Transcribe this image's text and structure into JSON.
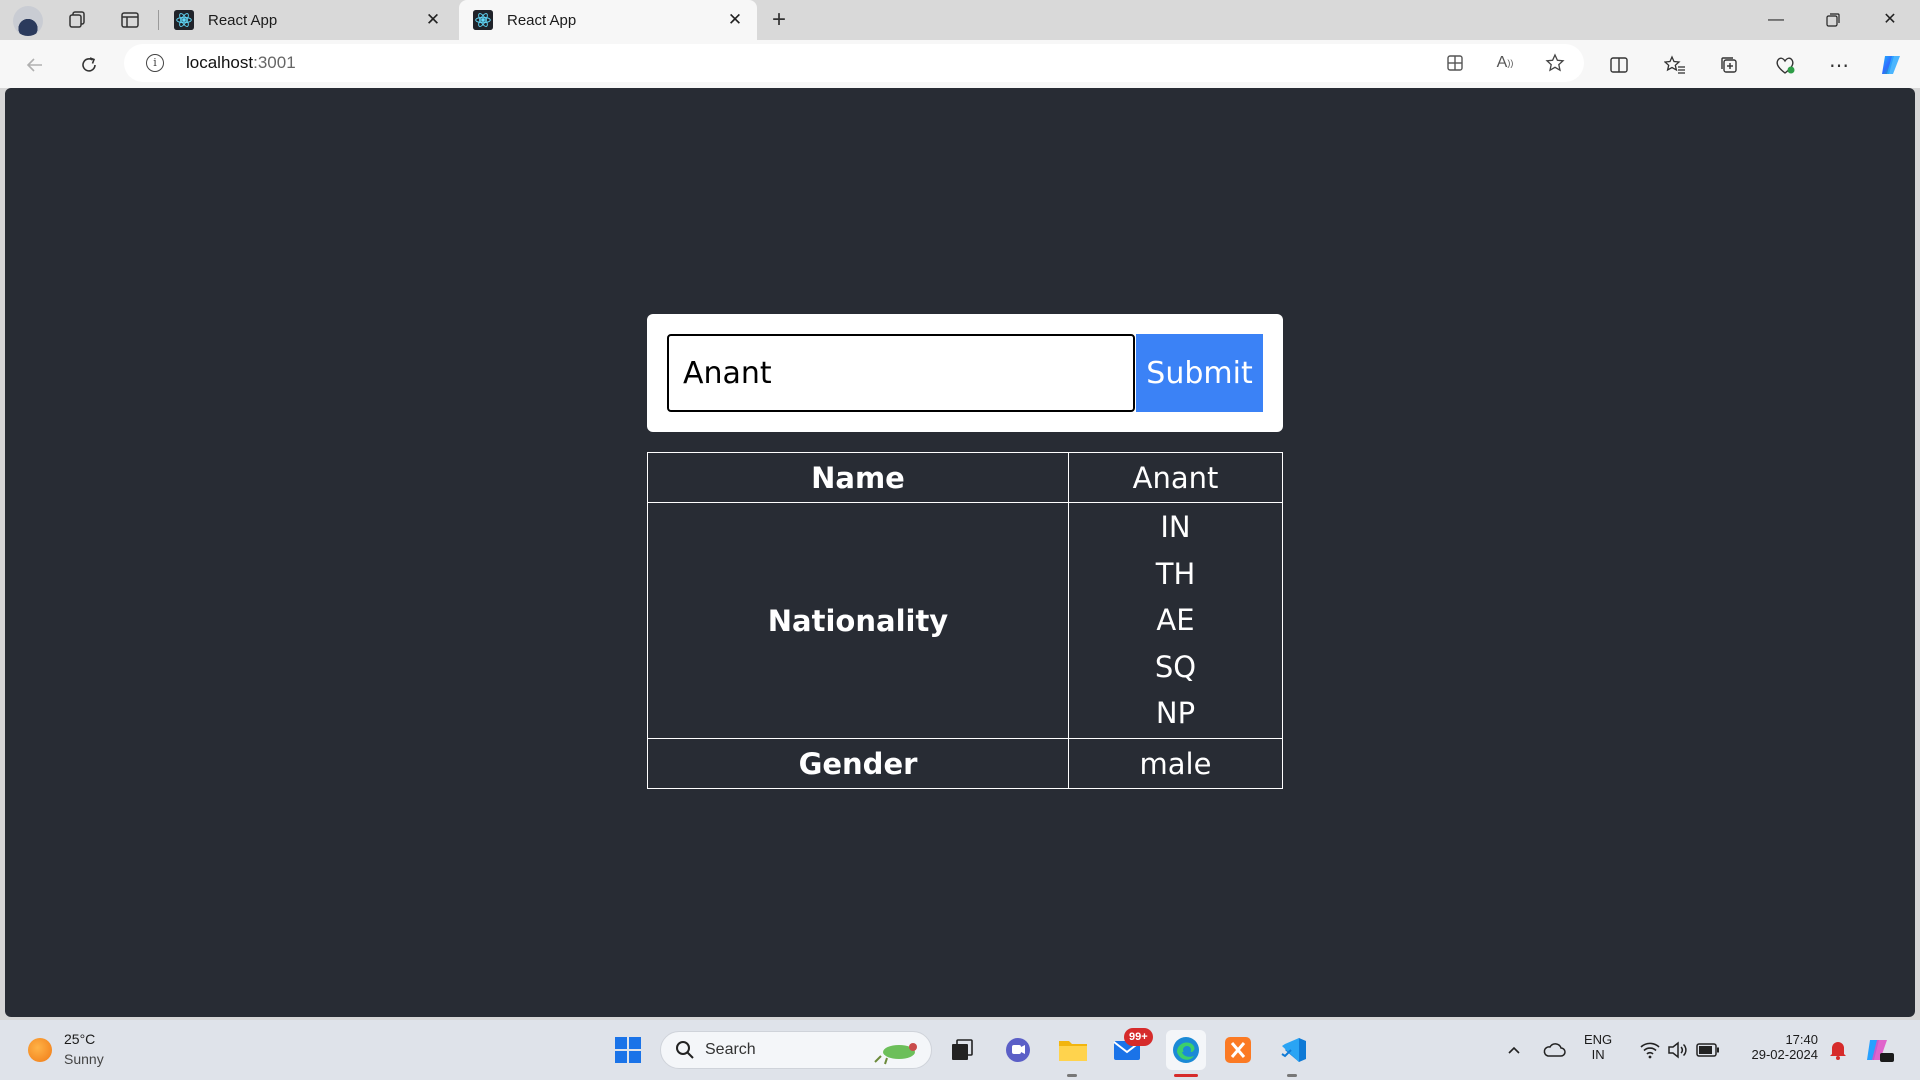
{
  "browser": {
    "tabs": [
      {
        "title": "React App"
      },
      {
        "title": "React App"
      }
    ],
    "address": {
      "host": "localhost",
      "port": ":3001"
    },
    "accent_color": "#1a73e8"
  },
  "page": {
    "input_value": "Anant",
    "submit_label": "Submit",
    "submit_color": "#3b82f6",
    "background_color": "#282c34",
    "rows": {
      "name_label": "Name",
      "name_value": "Anant",
      "nationality_label": "Nationality",
      "nationalities": [
        "IN",
        "TH",
        "AE",
        "SQ",
        "NP"
      ],
      "gender_label": "Gender",
      "gender_value": "male"
    }
  },
  "taskbar": {
    "weather_temp": "25°C",
    "weather_cond": "Sunny",
    "search_label": "Search",
    "mail_badge": "99+",
    "lang_top": "ENG",
    "lang_bottom": "IN",
    "time": "17:40",
    "date": "29-02-2024"
  }
}
